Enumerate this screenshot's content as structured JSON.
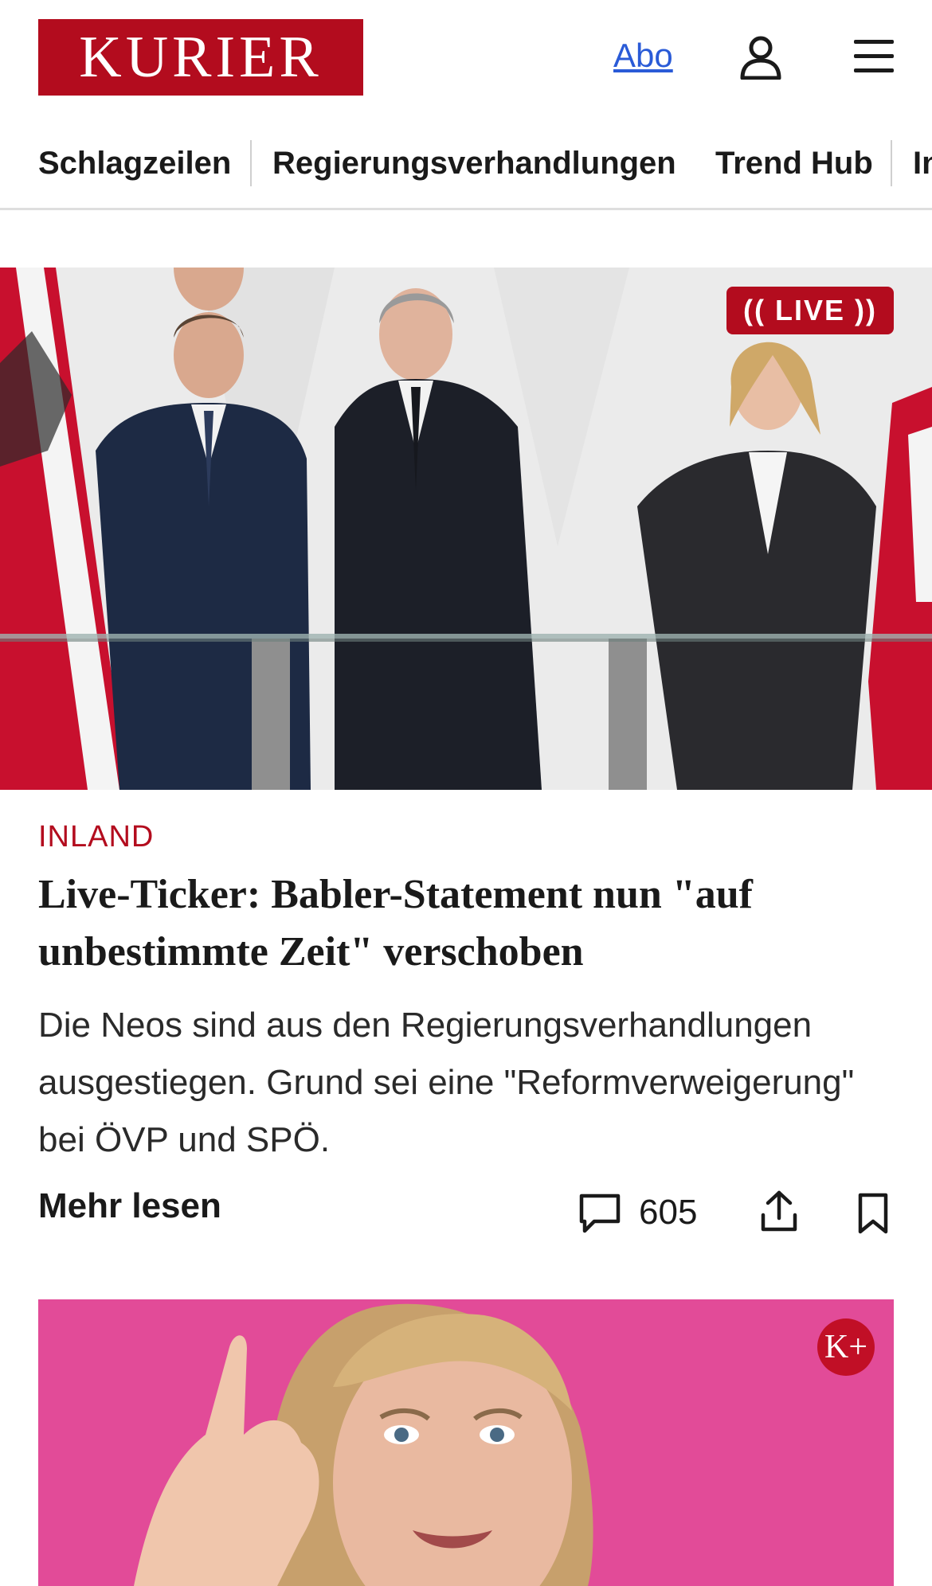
{
  "header": {
    "logo_text": "KURIER",
    "abo_label": "Abo",
    "user_icon": "user-icon",
    "menu_icon": "hamburger-menu-icon"
  },
  "nav": {
    "items": [
      {
        "label": "Schlagzeilen"
      },
      {
        "label": "Regierungsverhandlungen"
      },
      {
        "label": "Trend Hub"
      },
      {
        "label": "In"
      }
    ]
  },
  "hero": {
    "badge_label": "LIVE",
    "live_icon": "broadcast-icon"
  },
  "article": {
    "kicker": "INLAND",
    "headline": "Live-Ticker: Babler-Statement nun \"auf unbestimmte Zeit\" verschoben",
    "teaser": "Die Neos sind aus den Regierungsverhandlungen ausgestiegen. Grund sei eine \"Reformverweigerung\" bei ÖVP und SPÖ.",
    "more_label": "Mehr lesen",
    "comment_count": "605",
    "icons": [
      "comment-icon",
      "share-icon",
      "bookmark-icon"
    ]
  },
  "second_article": {
    "badge_label": "K+"
  },
  "colors": {
    "brand": "#b30c1e",
    "link": "#2a5bd7",
    "magenta_bg": "#e34c9a"
  }
}
